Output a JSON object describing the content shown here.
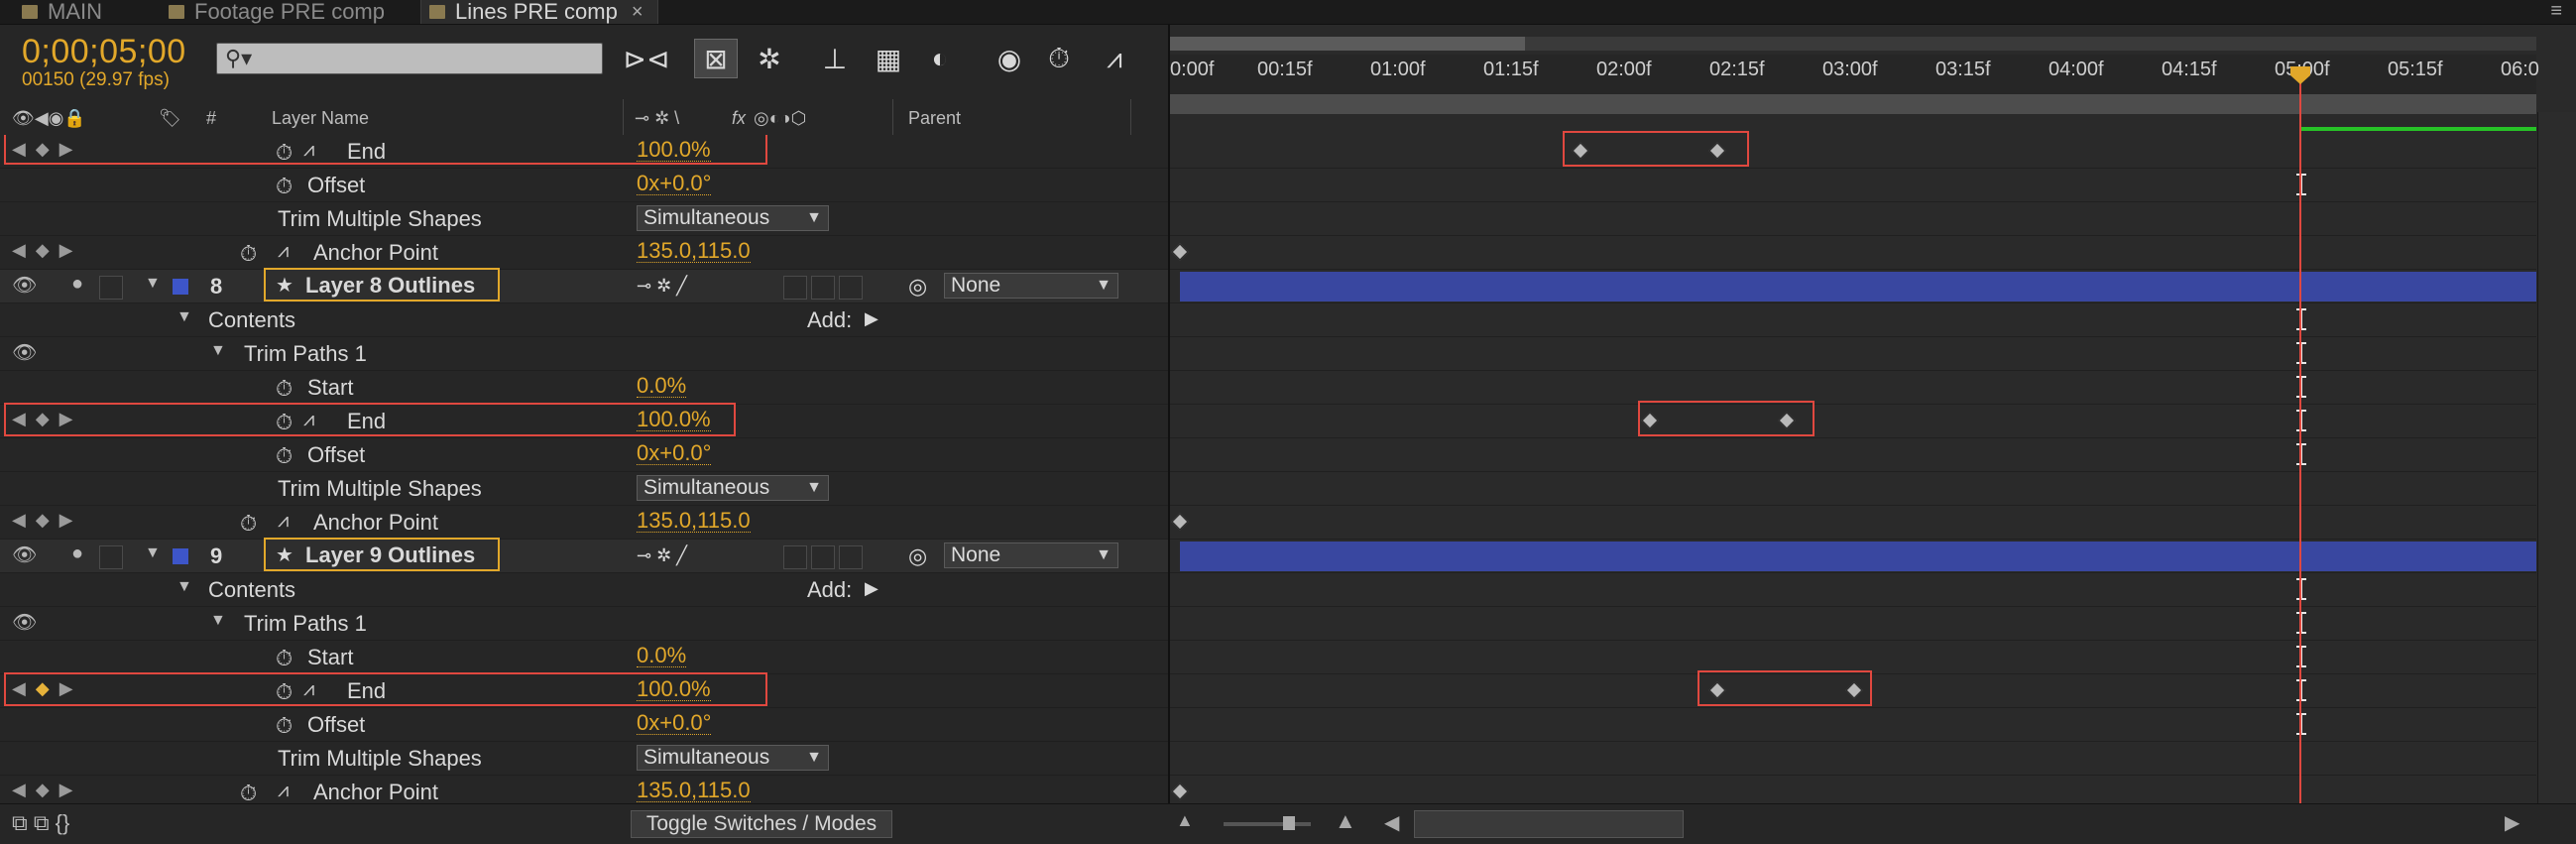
{
  "tabs": [
    {
      "label": "MAIN"
    },
    {
      "label": "Footage PRE comp"
    },
    {
      "label": "Lines PRE comp",
      "close": "×"
    }
  ],
  "tab_menu": "≡",
  "header": {
    "timecode": "0;00;05;00",
    "frame_info": "00150 (29.97 fps)",
    "search_placeholder": "",
    "search_icon": "⚲▾"
  },
  "columns": {
    "hash": "#",
    "layer_name": "Layer Name",
    "fx": "fx",
    "parent": "Parent"
  },
  "timeline": {
    "ticks": [
      "0:00f",
      "00:15f",
      "01:00f",
      "01:15f",
      "02:00f",
      "02:15f",
      "03:00f",
      "03:15f",
      "04:00f",
      "04:15f",
      "05:00f",
      "05:15f",
      "06:0"
    ]
  },
  "rows": [
    {
      "type": "prop",
      "name": "End",
      "value": "100.0%",
      "kf_nav": true,
      "stopwatch_active": true
    },
    {
      "type": "prop",
      "name": "Offset",
      "value": "0x+0.0°"
    },
    {
      "type": "select",
      "name": "Trim Multiple Shapes",
      "value": "Simultaneous"
    },
    {
      "type": "prop",
      "name": "Anchor Point",
      "value": "135.0,115.0",
      "kf_nav": true,
      "stopwatch_active": true
    },
    {
      "type": "layer",
      "num": "8",
      "name": "Layer 8 Outlines",
      "parent": "None"
    },
    {
      "type": "group",
      "name": "Contents",
      "add": "Add:"
    },
    {
      "type": "group2",
      "name": "Trim Paths 1"
    },
    {
      "type": "prop",
      "name": "Start",
      "value": "0.0%"
    },
    {
      "type": "prop",
      "name": "End",
      "value": "100.0%",
      "kf_nav": true,
      "stopwatch_active": true
    },
    {
      "type": "prop",
      "name": "Offset",
      "value": "0x+0.0°"
    },
    {
      "type": "select",
      "name": "Trim Multiple Shapes",
      "value": "Simultaneous"
    },
    {
      "type": "prop",
      "name": "Anchor Point",
      "value": "135.0,115.0",
      "kf_nav": true,
      "stopwatch_active": true
    },
    {
      "type": "layer",
      "num": "9",
      "name": "Layer 9 Outlines",
      "parent": "None"
    },
    {
      "type": "group",
      "name": "Contents",
      "add": "Add:"
    },
    {
      "type": "group2",
      "name": "Trim Paths 1"
    },
    {
      "type": "prop",
      "name": "Start",
      "value": "0.0%"
    },
    {
      "type": "prop",
      "name": "End",
      "value": "100.0%",
      "kf_nav": true,
      "kf_on": true,
      "stopwatch_active": true
    },
    {
      "type": "prop",
      "name": "Offset",
      "value": "0x+0.0°"
    },
    {
      "type": "select",
      "name": "Trim Multiple Shapes",
      "value": "Simultaneous"
    },
    {
      "type": "prop",
      "name": "Anchor Point",
      "value": "135.0,115.0",
      "kf_nav": true,
      "stopwatch_active": true
    }
  ],
  "footer": {
    "toggle_label": "Toggle Switches / Modes"
  }
}
